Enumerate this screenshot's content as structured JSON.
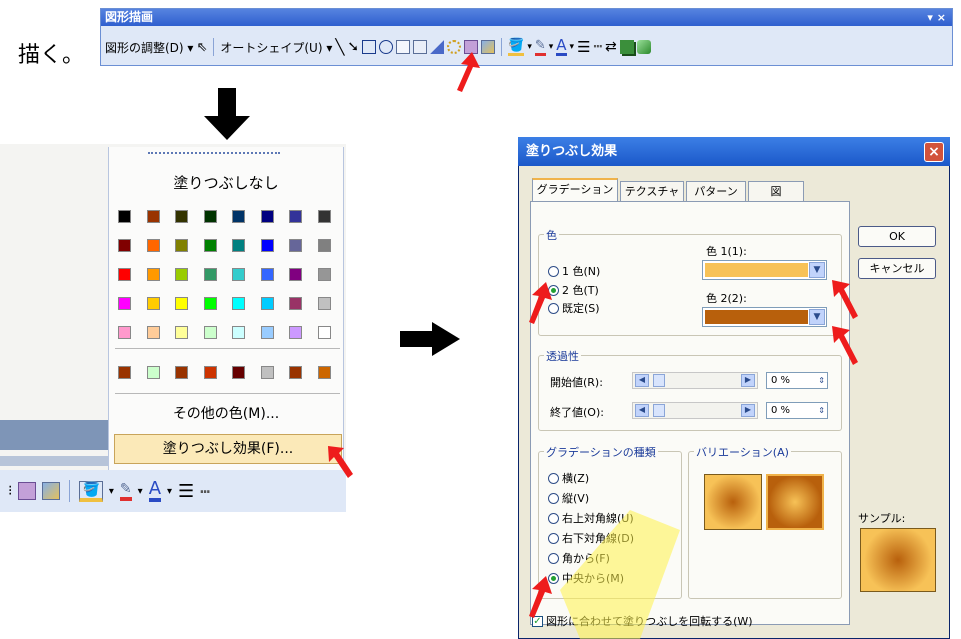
{
  "intro_label": "描く。",
  "toolbar": {
    "title": "図形描画",
    "window_ctrl": "▾ ×",
    "adjust_menu": "図形の調整(D) ▾",
    "autoshape_menu": "オートシェイプ(U) ▾"
  },
  "color_panel": {
    "no_fill": "塗りつぶしなし",
    "more_colors": "その他の色(M)...",
    "fill_effects": "塗りつぶし効果(F)...",
    "standard_colors": [
      "#000000",
      "#993300",
      "#333300",
      "#003300",
      "#003366",
      "#000080",
      "#333399",
      "#333333",
      "#800000",
      "#ff6600",
      "#808000",
      "#008000",
      "#008080",
      "#0000ff",
      "#666699",
      "#808080",
      "#ff0000",
      "#ff9900",
      "#99cc00",
      "#339966",
      "#33cccc",
      "#3366ff",
      "#800080",
      "#969696",
      "#ff00ff",
      "#ffcc00",
      "#ffff00",
      "#00ff00",
      "#00ffff",
      "#00ccff",
      "#993366",
      "#c0c0c0",
      "#ff99cc",
      "#ffcc99",
      "#ffff99",
      "#ccffcc",
      "#ccffff",
      "#99ccff",
      "#cc99ff",
      "#ffffff"
    ],
    "recent_colors": [
      "#993300",
      "#ccffcc",
      "#993300",
      "#cc3300",
      "#660000",
      "#c0c0c0",
      "#993300",
      "#cc6600"
    ]
  },
  "dialog": {
    "title": "塗りつぶし効果",
    "close": "×",
    "tabs": [
      "グラデーション",
      "テクスチャ",
      "パターン",
      "図"
    ],
    "ok": "OK",
    "cancel": "キャンセル",
    "color_group": "色",
    "color_options": [
      "1 色(N)",
      "2 色(T)",
      "既定(S)"
    ],
    "color1_label": "色 1(1):",
    "color2_label": "色 2(2):",
    "color1": "#f7c257",
    "color2": "#b8600c",
    "transparency_group": "透過性",
    "from_label": "開始値(R):",
    "to_label": "終了値(O):",
    "from_value": "0 %",
    "to_value": "0 %",
    "shading_group": "グラデーションの種類",
    "shading_options": [
      "横(Z)",
      "縦(V)",
      "右上対角線(U)",
      "右下対角線(D)",
      "角から(F)",
      "中央から(M)"
    ],
    "variants_label": "バリエーション(A)",
    "sample_label": "サンプル:",
    "rotate_label": "図形に合わせて塗りつぶしを回転する(W)"
  }
}
